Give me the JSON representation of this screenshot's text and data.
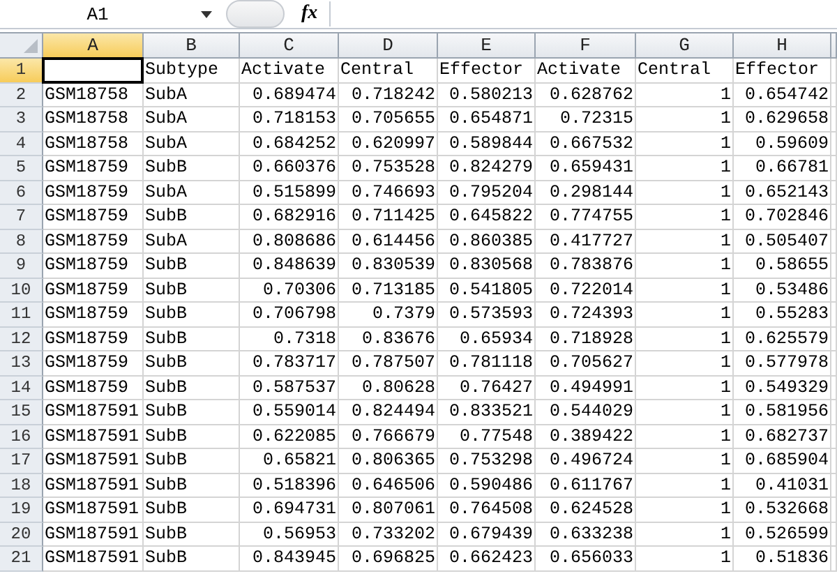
{
  "formula_bar": {
    "name_box": "A1",
    "fx": "fx"
  },
  "columns": [
    {
      "label": "A",
      "kind": "text",
      "selected": true
    },
    {
      "label": "B",
      "kind": "text",
      "selected": false
    },
    {
      "label": "C",
      "kind": "number",
      "selected": false
    },
    {
      "label": "D",
      "kind": "number",
      "selected": false
    },
    {
      "label": "E",
      "kind": "number",
      "selected": false
    },
    {
      "label": "F",
      "kind": "number",
      "selected": false
    },
    {
      "label": "G",
      "kind": "number",
      "selected": false
    },
    {
      "label": "H",
      "kind": "number",
      "selected": false
    }
  ],
  "rows": [
    {
      "label": "1",
      "kind": "header",
      "selected": true,
      "cells": [
        null,
        "Subtype",
        "Activate",
        "Central",
        "Effector",
        "Activate",
        "Central",
        "Effector"
      ]
    },
    {
      "label": "2",
      "kind": "data",
      "selected": false,
      "cells": [
        "GSM18758",
        "SubA",
        "0.689474",
        "0.718242",
        "0.580213",
        "0.628762",
        "1",
        "0.654742"
      ]
    },
    {
      "label": "3",
      "kind": "data",
      "selected": false,
      "cells": [
        "GSM18758",
        "SubA",
        "0.718153",
        "0.705655",
        "0.654871",
        "0.72315",
        "1",
        "0.629658"
      ]
    },
    {
      "label": "4",
      "kind": "data",
      "selected": false,
      "cells": [
        "GSM18758",
        "SubA",
        "0.684252",
        "0.620997",
        "0.589844",
        "0.667532",
        "1",
        "0.59609"
      ]
    },
    {
      "label": "5",
      "kind": "data",
      "selected": false,
      "cells": [
        "GSM18759",
        "SubB",
        "0.660376",
        "0.753528",
        "0.824279",
        "0.659431",
        "1",
        "0.66781"
      ]
    },
    {
      "label": "6",
      "kind": "data",
      "selected": false,
      "cells": [
        "GSM18759",
        "SubA",
        "0.515899",
        "0.746693",
        "0.795204",
        "0.298144",
        "1",
        "0.652143"
      ]
    },
    {
      "label": "7",
      "kind": "data",
      "selected": false,
      "cells": [
        "GSM18759",
        "SubB",
        "0.682916",
        "0.711425",
        "0.645822",
        "0.774755",
        "1",
        "0.702846"
      ]
    },
    {
      "label": "8",
      "kind": "data",
      "selected": false,
      "cells": [
        "GSM18759",
        "SubA",
        "0.808686",
        "0.614456",
        "0.860385",
        "0.417727",
        "1",
        "0.505407"
      ]
    },
    {
      "label": "9",
      "kind": "data",
      "selected": false,
      "cells": [
        "GSM18759",
        "SubB",
        "0.848639",
        "0.830539",
        "0.830568",
        "0.783876",
        "1",
        "0.58655"
      ]
    },
    {
      "label": "10",
      "kind": "data",
      "selected": false,
      "cells": [
        "GSM18759",
        "SubB",
        "0.70306",
        "0.713185",
        "0.541805",
        "0.722014",
        "1",
        "0.53486"
      ]
    },
    {
      "label": "11",
      "kind": "data",
      "selected": false,
      "cells": [
        "GSM18759",
        "SubB",
        "0.706798",
        "0.7379",
        "0.573593",
        "0.724393",
        "1",
        "0.55283"
      ]
    },
    {
      "label": "12",
      "kind": "data",
      "selected": false,
      "cells": [
        "GSM18759",
        "SubB",
        "0.7318",
        "0.83676",
        "0.65934",
        "0.718928",
        "1",
        "0.625579"
      ]
    },
    {
      "label": "13",
      "kind": "data",
      "selected": false,
      "cells": [
        "GSM18759",
        "SubB",
        "0.783717",
        "0.787507",
        "0.781118",
        "0.705627",
        "1",
        "0.577978"
      ]
    },
    {
      "label": "14",
      "kind": "data",
      "selected": false,
      "cells": [
        "GSM18759",
        "SubB",
        "0.587537",
        "0.80628",
        "0.76427",
        "0.494991",
        "1",
        "0.549329"
      ]
    },
    {
      "label": "15",
      "kind": "data",
      "selected": false,
      "cells": [
        "GSM187591",
        "SubB",
        "0.559014",
        "0.824494",
        "0.833521",
        "0.544029",
        "1",
        "0.581956"
      ]
    },
    {
      "label": "16",
      "kind": "data",
      "selected": false,
      "cells": [
        "GSM187591",
        "SubB",
        "0.622085",
        "0.766679",
        "0.77548",
        "0.389422",
        "1",
        "0.682737"
      ]
    },
    {
      "label": "17",
      "kind": "data",
      "selected": false,
      "cells": [
        "GSM187591",
        "SubB",
        "0.65821",
        "0.806365",
        "0.753298",
        "0.496724",
        "1",
        "0.685904"
      ]
    },
    {
      "label": "18",
      "kind": "data",
      "selected": false,
      "cells": [
        "GSM187591",
        "SubB",
        "0.518396",
        "0.646506",
        "0.590486",
        "0.611767",
        "1",
        "0.41031"
      ]
    },
    {
      "label": "19",
      "kind": "data",
      "selected": false,
      "cells": [
        "GSM187591",
        "SubB",
        "0.694731",
        "0.807061",
        "0.764508",
        "0.624528",
        "1",
        "0.532668"
      ]
    },
    {
      "label": "20",
      "kind": "data",
      "selected": false,
      "cells": [
        "GSM187591",
        "SubB",
        "0.56953",
        "0.733202",
        "0.679439",
        "0.633238",
        "1",
        "0.526599"
      ]
    },
    {
      "label": "21",
      "kind": "data",
      "selected": false,
      "cells": [
        "GSM187591",
        "SubB",
        "0.843945",
        "0.696825",
        "0.662423",
        "0.656033",
        "1",
        "0.51836"
      ]
    }
  ]
}
